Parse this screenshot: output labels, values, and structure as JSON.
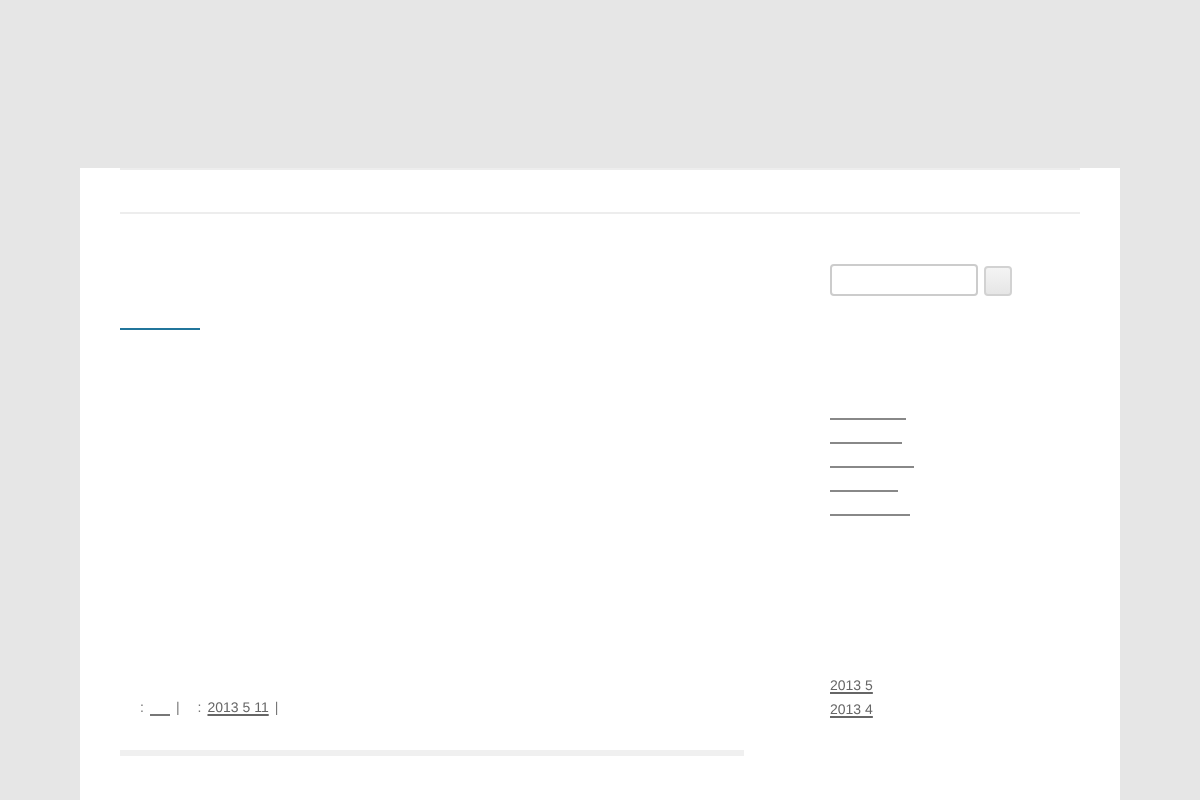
{
  "post_meta": {
    "author_prefix": ":",
    "author_separator": "|",
    "date_prefix": ":",
    "date": "2013 5 11",
    "date_separator": "|"
  },
  "archives": [
    "2013 5",
    "2013 4"
  ]
}
